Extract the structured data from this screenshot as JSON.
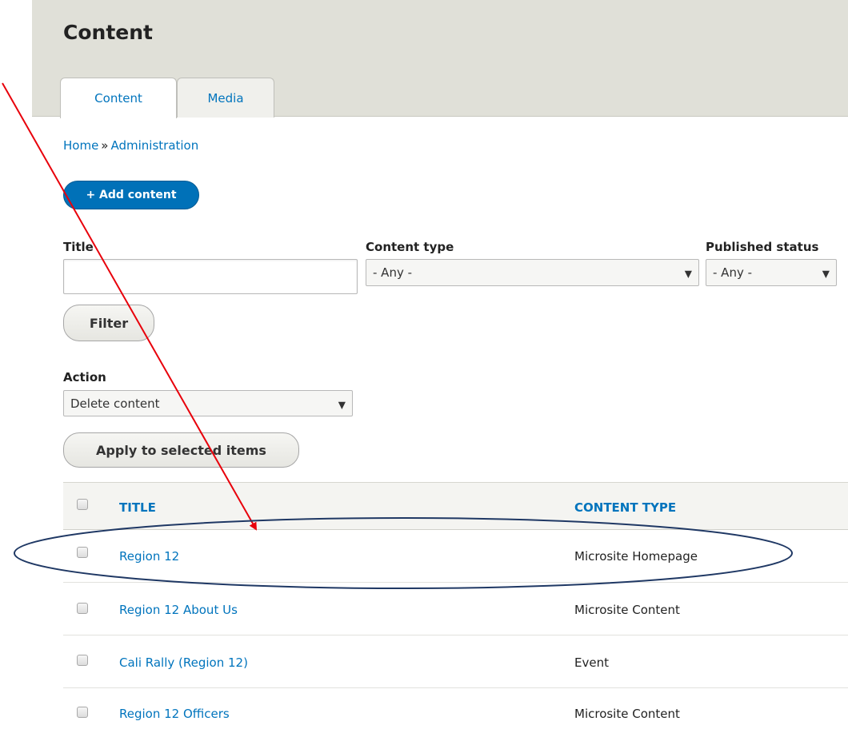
{
  "page": {
    "title": "Content"
  },
  "tabs": [
    {
      "label": "Content",
      "active": true
    },
    {
      "label": "Media",
      "active": false
    }
  ],
  "breadcrumb": {
    "home": "Home",
    "separator": "»",
    "admin": "Administration"
  },
  "add_button": {
    "label": "+ Add content"
  },
  "filters": {
    "title": {
      "label": "Title",
      "value": ""
    },
    "content_type": {
      "label": "Content type",
      "value": "- Any -"
    },
    "published_status": {
      "label": "Published status",
      "value": "- Any -"
    },
    "filter_button": "Filter"
  },
  "action": {
    "label": "Action",
    "value": "Delete content",
    "apply_button": "Apply to selected items"
  },
  "table": {
    "headers": {
      "title": "TITLE",
      "content_type": "CONTENT TYPE"
    },
    "rows": [
      {
        "title": "Region 12",
        "content_type": "Microsite Homepage",
        "highlighted": true
      },
      {
        "title": "Region 12 About Us",
        "content_type": "Microsite Content"
      },
      {
        "title": "Cali Rally (Region 12)",
        "content_type": "Event"
      },
      {
        "title": "Region 12 Officers",
        "content_type": "Microsite Content"
      }
    ]
  },
  "colors": {
    "link": "#0074bd",
    "primary_button": "#0071b8",
    "annotation_arrow": "#e8000b",
    "annotation_ellipse": "#1f3864"
  },
  "icons": {
    "dropdown": "caret-down-icon",
    "checkbox": "checkbox-icon"
  }
}
